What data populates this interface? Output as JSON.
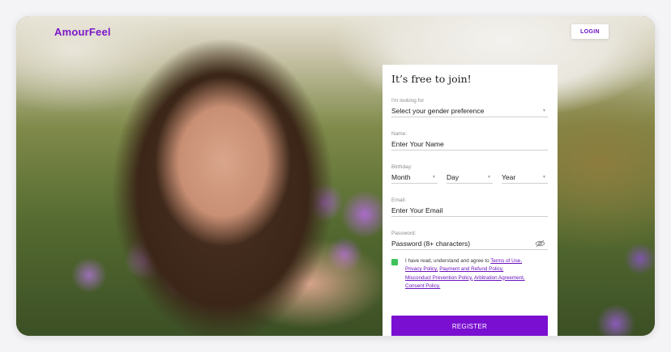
{
  "brand": {
    "name": "AmourFeel",
    "color": "#7a18c8"
  },
  "header": {
    "login_label": "LOGIN"
  },
  "form": {
    "title": "It’s free to join!",
    "looking_for": {
      "label": "I'm looking for",
      "value": "Select your gender preference"
    },
    "name": {
      "label": "Name:",
      "placeholder": "Enter Your Name"
    },
    "birthday": {
      "label": "Birthday:",
      "month": "Month",
      "day": "Day",
      "year": "Year"
    },
    "email": {
      "label": "Email:",
      "placeholder": "Enter Your Email"
    },
    "password": {
      "label": "Password:",
      "placeholder": "Password (8+ characters)"
    },
    "terms": {
      "checked": true,
      "prefix": "I have read, understand and agree to ",
      "link_terms": "Terms of Use,",
      "link_privacy": "Privacy Policy,",
      "link_payment": "Payment and Refund Policy,",
      "link_misconduct": "Misconduct Prevention Policy,",
      "link_arbitration": "Arbitration Agreement,",
      "link_consent": "Consent Policy."
    },
    "register_label": "REGISTER"
  },
  "colors": {
    "accent": "#7a0fd1",
    "checkbox": "#3ec35a"
  }
}
